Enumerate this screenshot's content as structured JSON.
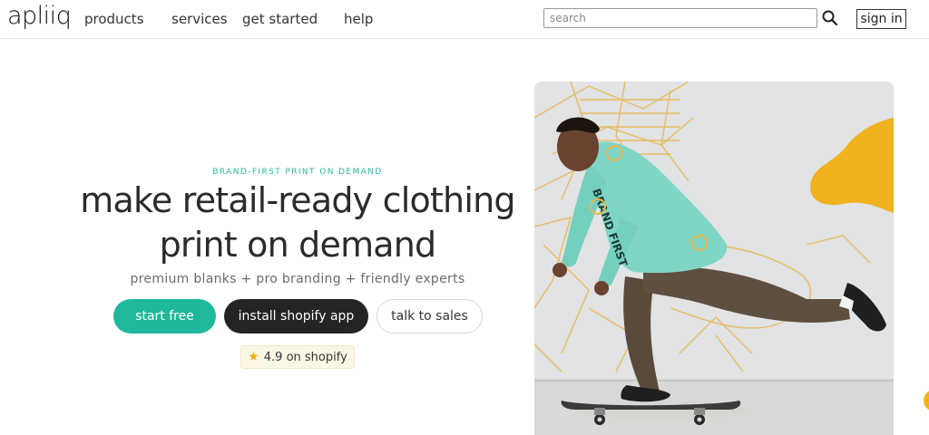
{
  "header": {
    "logo_text": "apliiq",
    "nav": {
      "products": "products",
      "services": "services",
      "get_started": "get started",
      "help": "help"
    },
    "search": {
      "placeholder": "search",
      "value": ""
    },
    "search_icon": "search-icon",
    "sign_in_label": "sign in"
  },
  "hero": {
    "eyebrow": "BRAND-FIRST PRINT ON DEMAND",
    "headline_line1": "make retail-ready clothing",
    "headline_line2": "print on demand",
    "subhead": "premium blanks + pro branding + friendly experts",
    "buttons": {
      "start_free": "start free",
      "install_shopify": "install shopify app",
      "talk_to_sales": "talk to sales"
    },
    "rating": {
      "icon": "star-icon",
      "text": "4.9 on shopify"
    },
    "image": {
      "subject": "skateboarder-photo",
      "shirt_text": "BRAND FIRST"
    }
  },
  "colors": {
    "accent_teal": "#1fb89a",
    "dark_button": "#242424",
    "eyebrow_teal": "#25b8a0",
    "star_gold": "#f2b318",
    "rating_bg": "#fbf7e6",
    "wall": "#e4e5e7",
    "mural_yellow": "#f0b21f",
    "shirt_mint": "#7fd6c6",
    "pants_brown": "#5a4a3c"
  }
}
